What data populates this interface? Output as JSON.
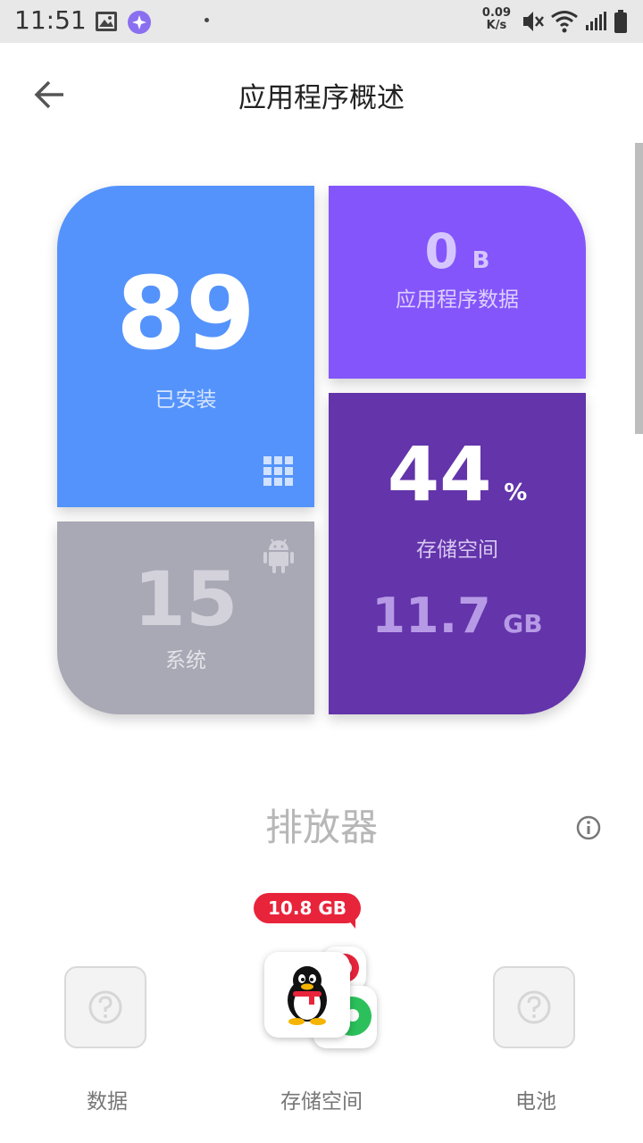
{
  "status_bar": {
    "time": "11:51",
    "net_speed": "0.09",
    "net_unit": "K/s"
  },
  "header": {
    "title": "应用程序概述"
  },
  "tiles": {
    "installed": {
      "value": "89",
      "label": "已安装"
    },
    "app_data": {
      "value": "0",
      "unit": "B",
      "label": "应用程序数据"
    },
    "system": {
      "value": "15",
      "label": "系统"
    },
    "storage": {
      "value": "44",
      "unit": "%",
      "label": "存储空间",
      "size_value": "11.7",
      "size_unit": "GB"
    }
  },
  "drainers": {
    "title": "排放器",
    "items": [
      {
        "label": "数据"
      },
      {
        "label": "存储空间",
        "badge": "10.8 GB"
      },
      {
        "label": "电池"
      }
    ]
  },
  "colors": {
    "installed": "#5493fb",
    "app_data": "#8455fb",
    "system": "#a9a8b5",
    "storage": "#6334aa",
    "badge": "#e8243b"
  }
}
